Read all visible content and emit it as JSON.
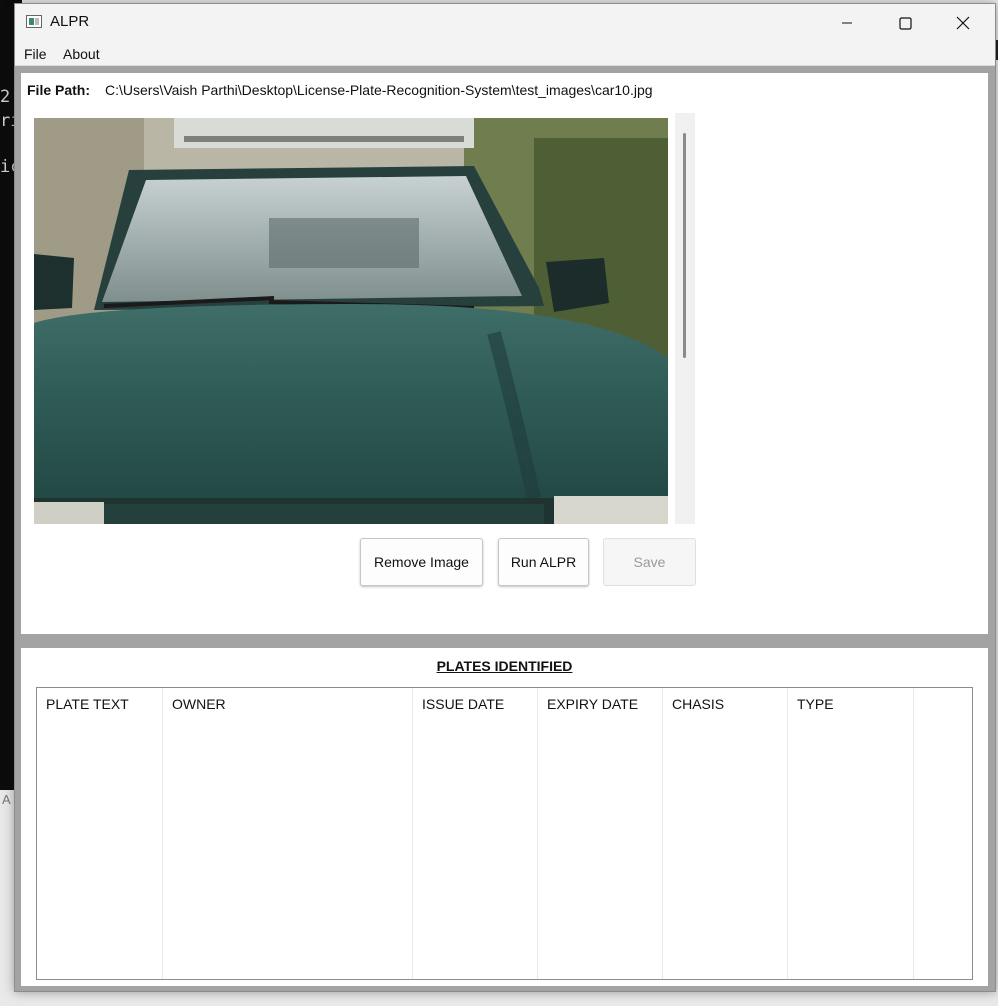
{
  "background_terminal": {
    "lines": [
      "2",
      "ri",
      "ic"
    ],
    "footer": "A"
  },
  "window": {
    "title": "ALPR",
    "controls": {
      "minimize": "—",
      "maximize": "☐",
      "close": "✕"
    }
  },
  "menu": {
    "items": [
      "File",
      "About"
    ]
  },
  "file_path": {
    "label": "File Path:",
    "value": "C:\\Users\\Vaish Parthi\\Desktop\\License-Plate-Recognition-System\\test_images\\car10.jpg"
  },
  "image": {
    "subject": "green car front view",
    "icon": "car-photo"
  },
  "buttons": {
    "remove": "Remove Image",
    "run": "Run ALPR",
    "save": "Save"
  },
  "results": {
    "title": "PLATES IDENTIFIED",
    "columns": [
      "PLATE TEXT",
      "OWNER",
      "ISSUE DATE",
      "EXPIRY DATE",
      "CHASIS",
      "TYPE"
    ],
    "rows": []
  },
  "colors": {
    "window_frame": "#a3a3a3",
    "titlebar": "#f3f3f3",
    "car_body": "#2d5b56"
  }
}
